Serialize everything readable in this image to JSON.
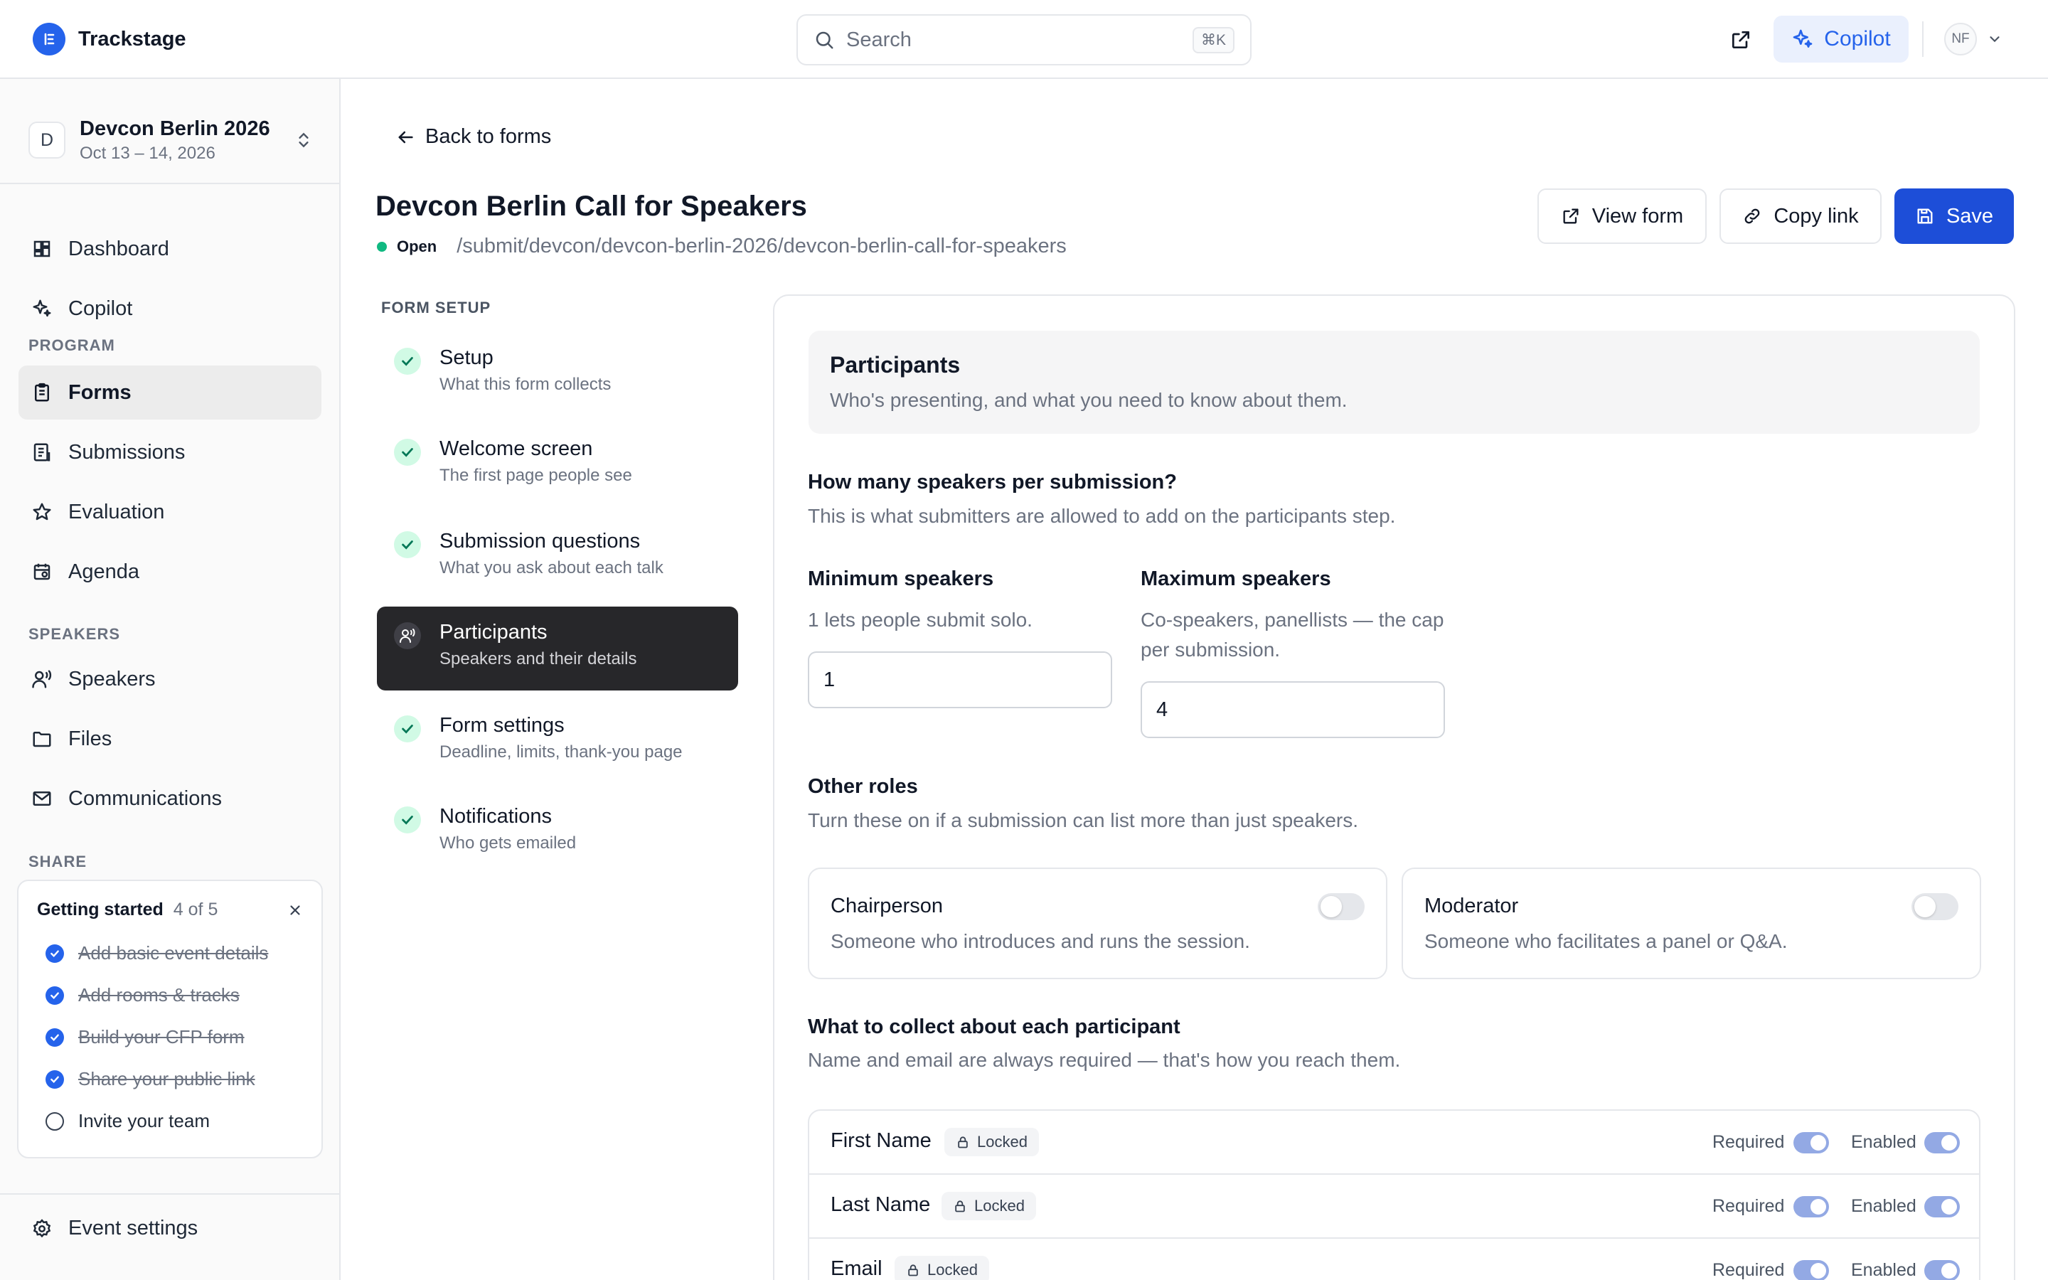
{
  "app": {
    "name": "Trackstage"
  },
  "topbar": {
    "search_placeholder": "Search",
    "search_shortcut": "⌘K",
    "copilot_label": "Copilot",
    "avatar_initials": "NF"
  },
  "sidebar": {
    "event": {
      "initial": "D",
      "name": "Devcon Berlin 2026",
      "dates": "Oct 13 – 14, 2026"
    },
    "top_items": [
      {
        "label": "Dashboard",
        "icon": "dashboard-icon"
      },
      {
        "label": "Copilot",
        "icon": "sparkles-icon"
      }
    ],
    "program_section": "PROGRAM",
    "program_items": [
      {
        "label": "Forms",
        "icon": "clipboard-icon",
        "active": true
      },
      {
        "label": "Submissions",
        "icon": "document-list-icon"
      },
      {
        "label": "Evaluation",
        "icon": "star-icon"
      },
      {
        "label": "Agenda",
        "icon": "calendar-icon"
      }
    ],
    "speakers_section": "SPEAKERS",
    "speakers_items": [
      {
        "label": "Speakers",
        "icon": "speaker-user-icon"
      },
      {
        "label": "Files",
        "icon": "folder-icon"
      },
      {
        "label": "Communications",
        "icon": "mail-icon"
      }
    ],
    "share_section": "SHARE",
    "getting_started": {
      "title": "Getting started",
      "count": "4 of 5",
      "items": [
        {
          "label": "Add basic event details",
          "done": true
        },
        {
          "label": "Add rooms & tracks",
          "done": true
        },
        {
          "label": "Build your CFP form",
          "done": true
        },
        {
          "label": "Share your public link",
          "done": true
        },
        {
          "label": "Invite your team",
          "done": false
        }
      ]
    },
    "event_settings_label": "Event settings"
  },
  "main": {
    "back_label": "Back to forms",
    "title": "Devcon Berlin Call for Speakers",
    "status": "Open",
    "path": "/submit/devcon/devcon-berlin-2026/devcon-berlin-call-for-speakers",
    "actions": {
      "view_form": "View form",
      "copy_link": "Copy link",
      "save": "Save"
    },
    "accent_color": "#1d4ed8"
  },
  "steps": {
    "heading": "FORM SETUP",
    "items": [
      {
        "title": "Setup",
        "sub": "What this form collects",
        "complete": true
      },
      {
        "title": "Welcome screen",
        "sub": "The first page people see",
        "complete": true
      },
      {
        "title": "Submission questions",
        "sub": "What you ask about each talk",
        "complete": true
      },
      {
        "title": "Participants",
        "sub": "Speakers and their details",
        "active": true
      },
      {
        "title": "Form settings",
        "sub": "Deadline, limits, thank-you page",
        "complete": true
      },
      {
        "title": "Notifications",
        "sub": "Who gets emailed",
        "complete": true
      }
    ]
  },
  "panel": {
    "header_title": "Participants",
    "header_sub": "Who's presenting, and what you need to know about them.",
    "speakers_q": "How many speakers per submission?",
    "speakers_q_sub": "This is what submitters are allowed to add on the participants step.",
    "min": {
      "label": "Minimum speakers",
      "help": "1 lets people submit solo.",
      "value": "1"
    },
    "max": {
      "label": "Maximum speakers",
      "help": "Co-speakers, panellists — the cap per submission.",
      "value": "4"
    },
    "roles_q": "Other roles",
    "roles_q_sub": "Turn these on if a submission can list more than just speakers.",
    "roles": [
      {
        "title": "Chairperson",
        "sub": "Someone who introduces and runs the session.",
        "enabled": false
      },
      {
        "title": "Moderator",
        "sub": "Someone who facilitates a panel or Q&A.",
        "enabled": false
      }
    ],
    "collect_q": "What to collect about each participant",
    "collect_q_sub": "Name and email are always required — that's how you reach them.",
    "fields": [
      {
        "name": "First Name",
        "badge": "Locked",
        "required_label": "Required",
        "enabled_label": "Enabled",
        "required": true,
        "enabled": true
      },
      {
        "name": "Last Name",
        "badge": "Locked",
        "required_label": "Required",
        "enabled_label": "Enabled",
        "required": true,
        "enabled": true
      },
      {
        "name": "Email",
        "badge": "Locked",
        "required_label": "Required",
        "enabled_label": "Enabled",
        "required": true,
        "enabled": true
      }
    ]
  }
}
